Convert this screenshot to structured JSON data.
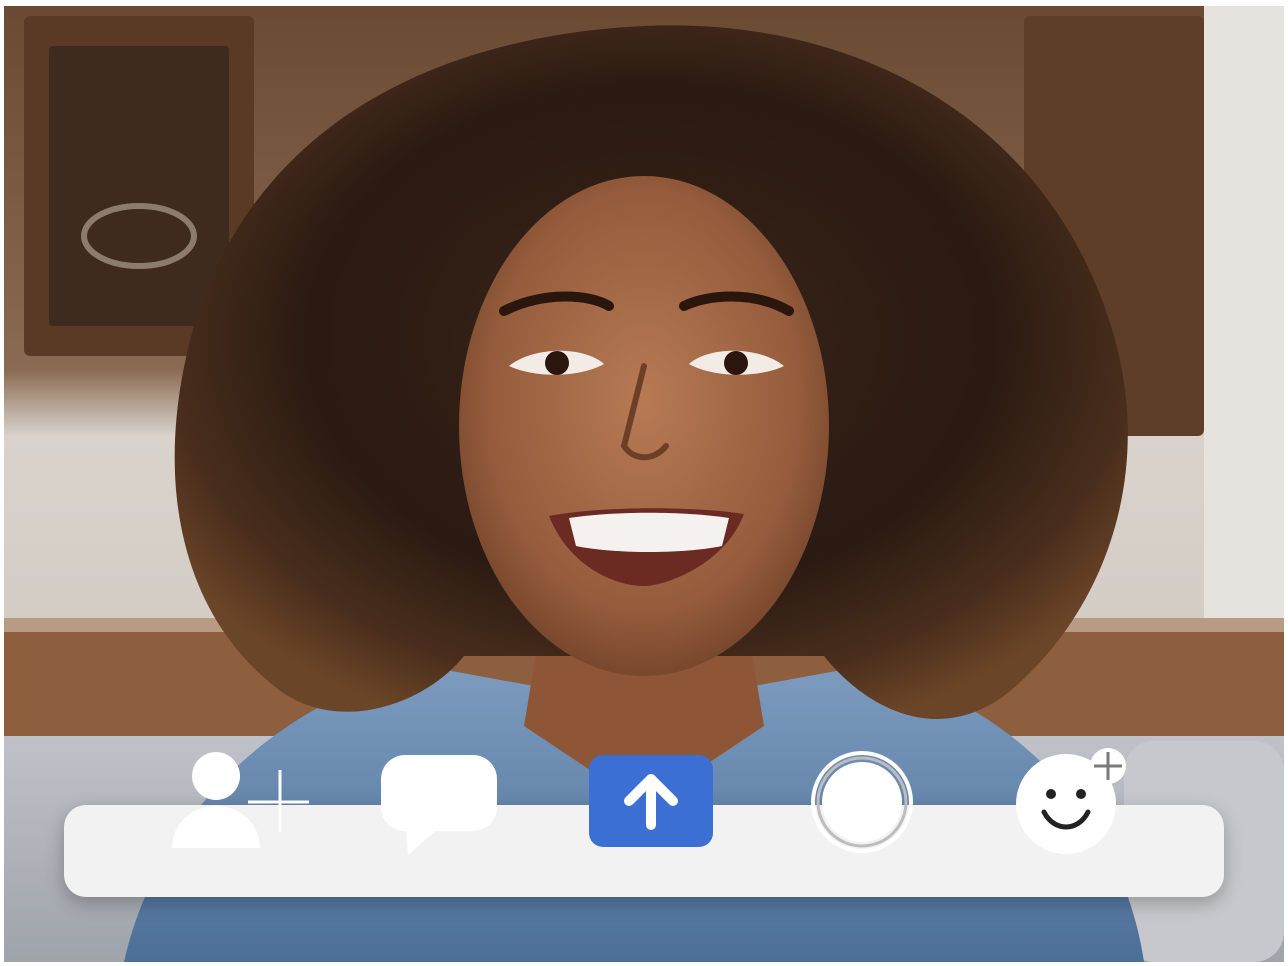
{
  "scene": {
    "description_icon": "video-call-participant",
    "toolbar": {
      "items": [
        {
          "name": "invite-participant-icon",
          "color": "#ffffff"
        },
        {
          "name": "chat-bubble-icon",
          "color": "#ffffff"
        },
        {
          "name": "share-screen-arrow-icon",
          "color": "#3b6fd4"
        },
        {
          "name": "record-circle-icon",
          "color": "#ffffff"
        },
        {
          "name": "add-reaction-icon",
          "color": "#ffffff"
        }
      ],
      "background": "#f2f2f2",
      "accent": "#3b6fd4"
    }
  }
}
